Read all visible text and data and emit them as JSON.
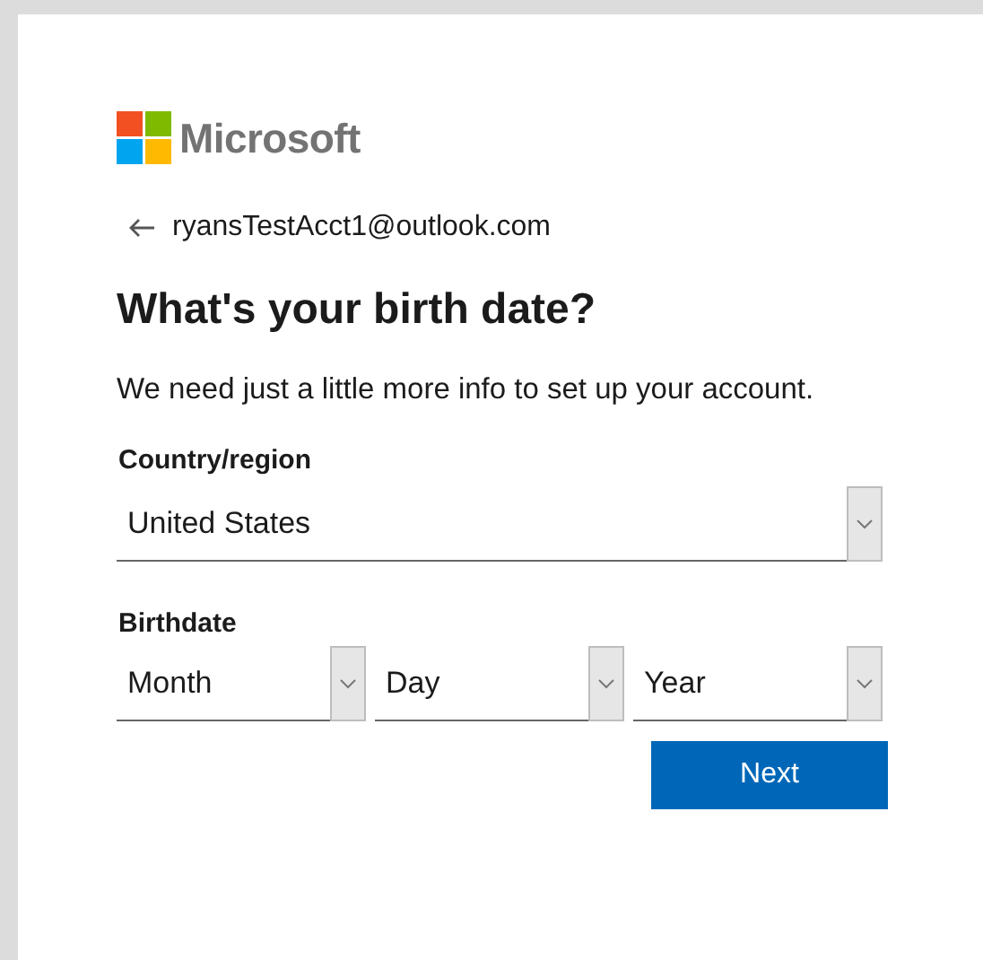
{
  "logo": {
    "text": "Microsoft"
  },
  "account": {
    "email": "ryansTestAcct1@outlook.com"
  },
  "heading": "What's your birth date?",
  "description": "We need just a little more info to set up your account.",
  "country": {
    "label": "Country/region",
    "value": "United States"
  },
  "birthdate": {
    "label": "Birthdate",
    "fields": [
      {
        "value": "Month"
      },
      {
        "value": "Day"
      },
      {
        "value": "Year"
      }
    ]
  },
  "buttons": [
    {
      "label": "Next"
    }
  ]
}
